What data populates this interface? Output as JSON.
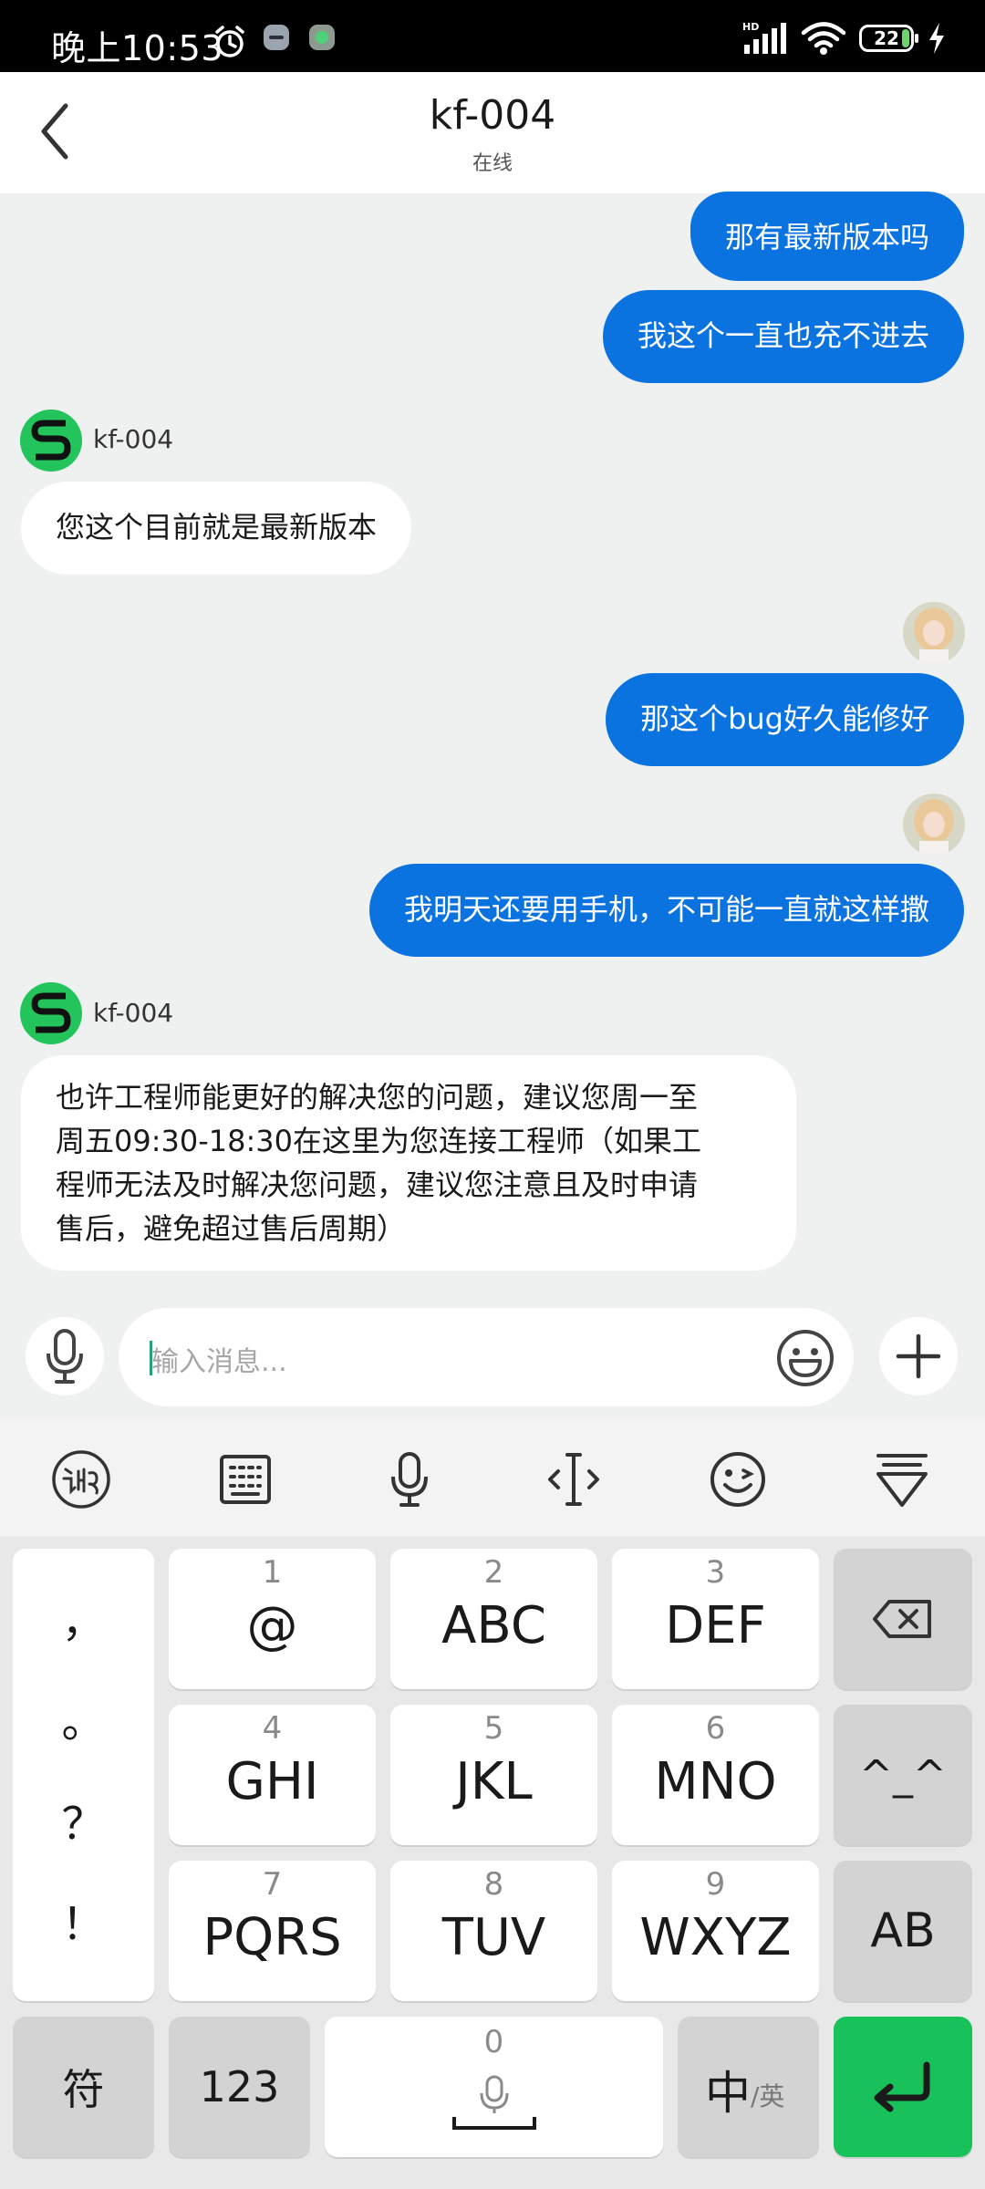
{
  "status_bar": {
    "time": "晚上10:53",
    "battery": "22",
    "network": "HD"
  },
  "header": {
    "title": "kf-004",
    "subtitle": "在线"
  },
  "messages": [
    {
      "from": "user",
      "text": "那有最新版本吗"
    },
    {
      "from": "user",
      "text": "我这个一直也充不进去"
    },
    {
      "from": "agent",
      "name": "kf-004",
      "text": "您这个目前就是最新版本"
    },
    {
      "from": "user",
      "text": "那这个bug好久能修好"
    },
    {
      "from": "user",
      "text": "我明天还要用手机，不可能一直就这样撒"
    },
    {
      "from": "agent",
      "name": "kf-004",
      "lines": [
        "也许工程师能更好的解决您的问题，建议您周一至",
        "周五09:30-18:30在这里为您连接工程师（如果工",
        "程师无法及时解决您问题，建议您注意且及时申请",
        "售后，避免超过售后周期）"
      ]
    }
  ],
  "composer": {
    "placeholder": "输入消息..."
  },
  "keyboard": {
    "punct": [
      "，",
      "。",
      "？",
      "！"
    ],
    "keys": [
      {
        "num": "1",
        "letters": "@"
      },
      {
        "num": "2",
        "letters": "ABC"
      },
      {
        "num": "3",
        "letters": "DEF"
      },
      {
        "num": "4",
        "letters": "GHI"
      },
      {
        "num": "5",
        "letters": "JKL"
      },
      {
        "num": "6",
        "letters": "MNO"
      },
      {
        "num": "7",
        "letters": "PQRS"
      },
      {
        "num": "8",
        "letters": "TUV"
      },
      {
        "num": "9",
        "letters": "WXYZ"
      }
    ],
    "emoticon": "^_^",
    "case_key": "AB",
    "symbol_key": "符",
    "num_key": "123",
    "space_num": "0",
    "lang_main": "中",
    "lang_sub": "/英"
  }
}
